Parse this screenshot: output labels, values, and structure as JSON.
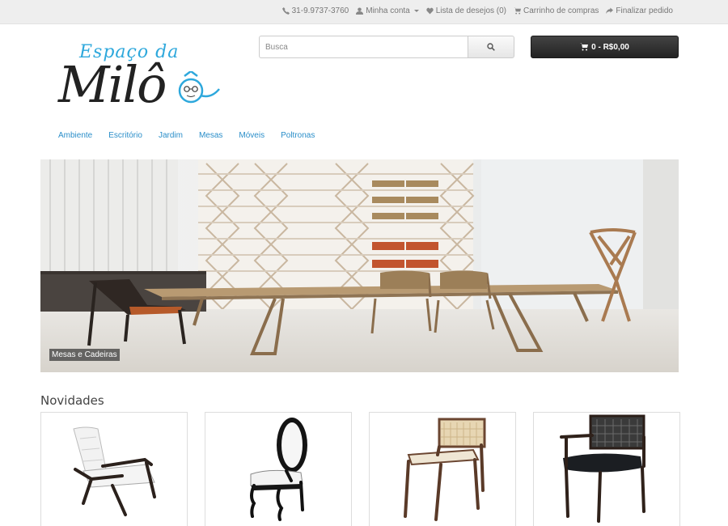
{
  "topbar": {
    "phone": "31-9.9737-3760",
    "account": "Minha conta",
    "wishlist": "Lista de desejos (0)",
    "cart": "Carrinho de compras",
    "checkout": "Finalizar pedido"
  },
  "logo": {
    "line1": "Espaço da",
    "line2": "Milô"
  },
  "search": {
    "placeholder": "Busca"
  },
  "cart_button": {
    "label": "0 - R$0,00"
  },
  "menu": [
    "Ambiente",
    "Escritório",
    "Jardim",
    "Mesas",
    "Móveis",
    "Poltronas"
  ],
  "hero": {
    "caption": "Mesas e Cadeiras"
  },
  "section": {
    "title": "Novidades"
  },
  "colors": {
    "link": "#2a8ec9",
    "logo_accent": "#2ea8dc",
    "cart_bg": "#2b2b2b"
  },
  "icons": [
    "phone-icon",
    "user-icon",
    "heart-icon",
    "cart-icon",
    "share-icon",
    "search-icon"
  ]
}
